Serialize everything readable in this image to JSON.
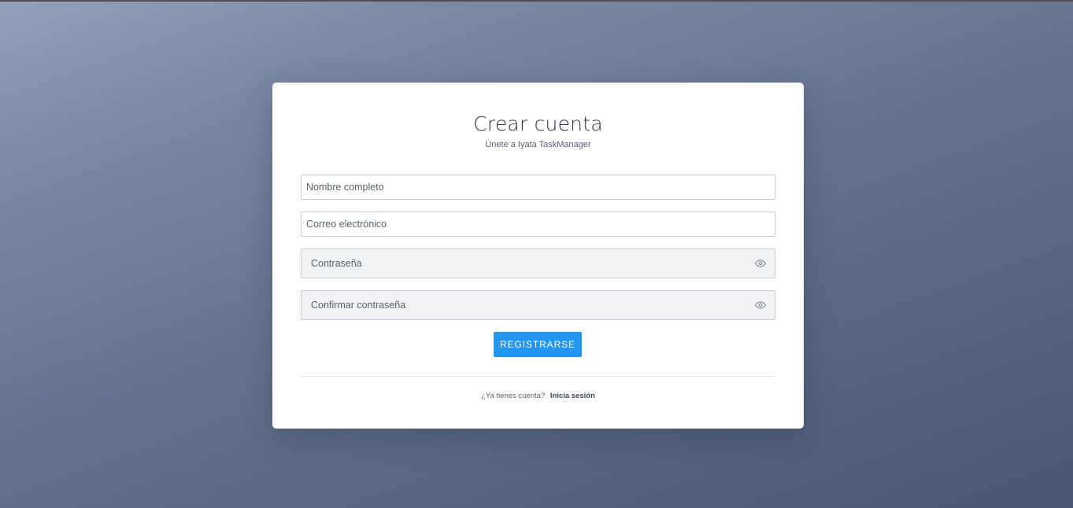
{
  "page": {
    "title": "Crear cuenta",
    "subtitle": "Únete a Iyata TaskManager"
  },
  "form": {
    "name": {
      "placeholder": "Nombre completo",
      "value": ""
    },
    "email": {
      "placeholder": "Correo electrónico",
      "value": ""
    },
    "password": {
      "placeholder": "Contraseña",
      "value": "",
      "toggle_icon": "eye-icon"
    },
    "confirm_password": {
      "placeholder": "Confirmar contraseña",
      "value": "",
      "toggle_icon": "eye-icon"
    },
    "submit_label": "REGISTRARSE"
  },
  "footer": {
    "prompt": "¿Ya tienes cuenta?",
    "link_label": "Inicia sesión"
  },
  "colors": {
    "accent": "#2196f3",
    "card": "#ffffff",
    "input_muted_bg": "#f1f2f4"
  }
}
